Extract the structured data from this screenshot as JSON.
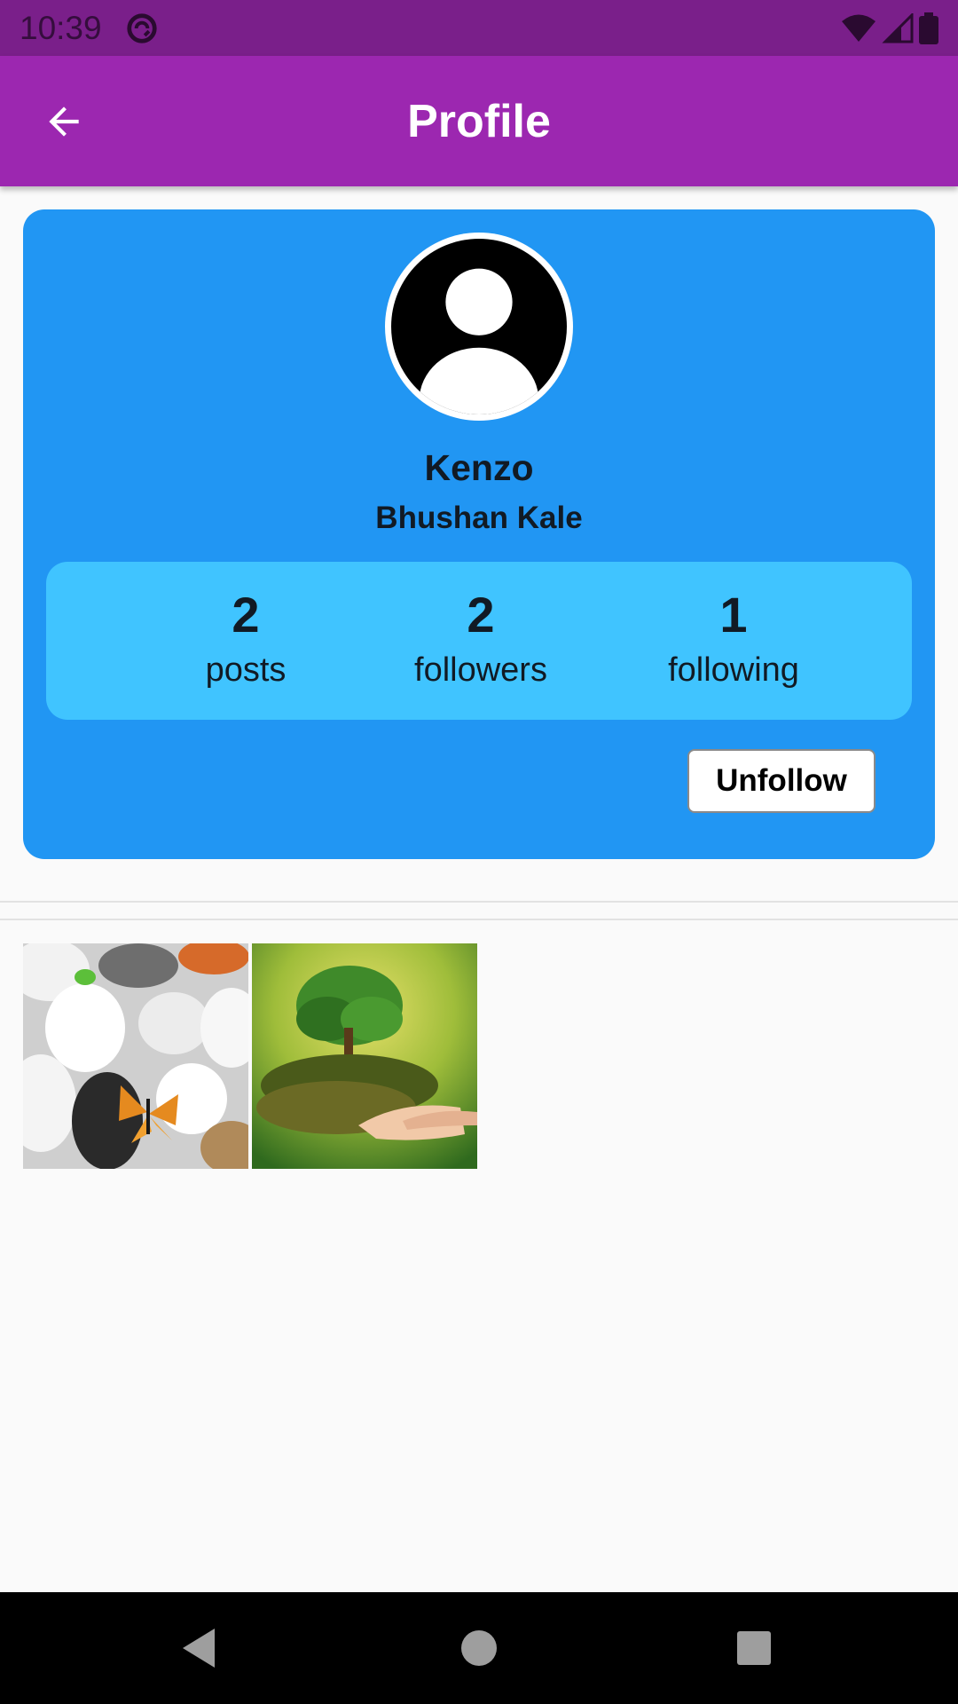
{
  "status_bar": {
    "time": "10:39",
    "icons": [
      "sync-icon",
      "wifi-icon",
      "signal-icon",
      "battery-icon"
    ]
  },
  "app_bar": {
    "title": "Profile",
    "back_icon": "arrow-back-icon",
    "color": "#9c27b0"
  },
  "profile": {
    "avatar_icon": "account-circle-icon",
    "username": "Kenzo",
    "full_name": "Bhushan Kale",
    "card_color": "#2196f3",
    "stats_color": "#40c4ff",
    "stats": [
      {
        "value": "2",
        "label": "posts"
      },
      {
        "value": "2",
        "label": "followers"
      },
      {
        "value": "1",
        "label": "following"
      }
    ],
    "action_label": "Unfollow"
  },
  "posts": [
    {
      "image": "pebbles-with-butterfly"
    },
    {
      "image": "tree-in-hands"
    }
  ],
  "nav_bar": {
    "icons": [
      "back-triangle-icon",
      "home-circle-icon",
      "recents-square-icon"
    ]
  }
}
